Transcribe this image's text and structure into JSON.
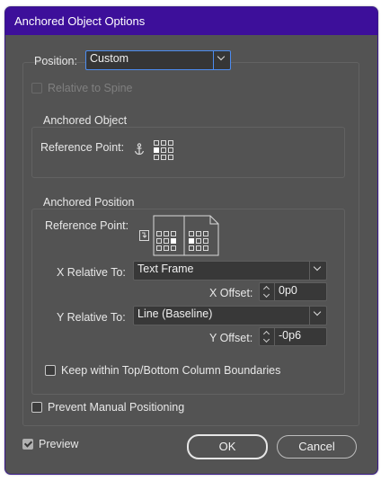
{
  "window": {
    "title": "Anchored Object Options"
  },
  "position": {
    "label": "Position:",
    "value": "Custom"
  },
  "relative_to_spine": {
    "label": "Relative to Spine",
    "checked": false,
    "enabled": false
  },
  "anchored_object": {
    "legend": "Anchored Object",
    "reference_point_label": "Reference Point:"
  },
  "anchored_position": {
    "legend": "Anchored Position",
    "reference_point_label": "Reference Point:",
    "x_relative_label": "X Relative To:",
    "x_relative_value": "Text Frame",
    "x_offset_label": "X Offset:",
    "x_offset_value": "0p0",
    "y_relative_label": "Y Relative To:",
    "y_relative_value": "Line (Baseline)",
    "y_offset_label": "Y Offset:",
    "y_offset_value": "-0p6",
    "keep_within_label": "Keep within Top/Bottom Column Boundaries",
    "keep_within_checked": false
  },
  "prevent_manual": {
    "label": "Prevent Manual Positioning",
    "checked": false
  },
  "preview": {
    "label": "Preview",
    "checked": true
  },
  "buttons": {
    "ok": "OK",
    "cancel": "Cancel"
  },
  "icons": {
    "anchor": "anchor-icon",
    "reference_grid": "reference-point-grid-icon",
    "page_spread": "page-spread-icon",
    "spine_toggle": "spine-toggle-icon"
  },
  "colors": {
    "title_bar": "#3d0f9a",
    "dialog_bg": "#535353",
    "focus": "#4c8cf0"
  }
}
